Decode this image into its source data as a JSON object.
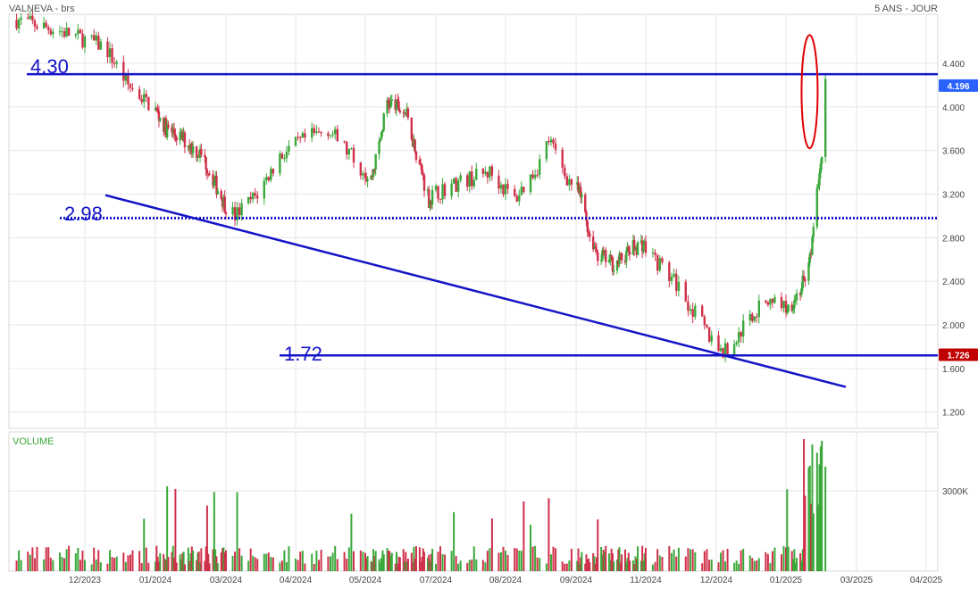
{
  "header": {
    "instrument": "VALNEVA - brs",
    "period": "5 ANS - JOUR"
  },
  "chart_data": {
    "type": "candlestick",
    "price_axis": {
      "ticks": [
        1.2,
        1.6,
        2.0,
        2.4,
        2.8,
        3.2,
        3.6,
        4.0,
        4.4
      ],
      "tick_labels": [
        "1.200",
        "1.600",
        "2.000",
        "2.400",
        "2.800",
        "3.200",
        "3.600",
        "4.000",
        "4.400"
      ],
      "range": [
        1.05,
        4.85
      ]
    },
    "x_axis": {
      "labels": [
        "12/2023",
        "01/2024",
        "03/2024",
        "04/2024",
        "05/2024",
        "07/2024",
        "08/2024",
        "09/2024",
        "11/2024",
        "12/2024",
        "01/2025",
        "03/2025",
        "04/2025"
      ]
    },
    "levels": [
      {
        "value": 4.3,
        "label": "4.30",
        "style": "solid"
      },
      {
        "value": 2.98,
        "label": "2.98",
        "style": "dotted"
      },
      {
        "value": 1.72,
        "label": "1.72",
        "style": "solid"
      }
    ],
    "trendline": {
      "from": {
        "date": "2023-12-10",
        "value": 3.19
      },
      "to": {
        "date": "2025-02-20",
        "value": 1.43
      }
    },
    "last_price": {
      "value": 4.196,
      "label": "4.196",
      "color": "#2962ff"
    },
    "low_price": {
      "value": 1.726,
      "label": "1.726",
      "color": "#c00000"
    },
    "highlight": {
      "type": "ellipse",
      "center_date": "2025-01-20",
      "value_range": [
        3.62,
        4.66
      ],
      "color": "#e00000"
    },
    "series": {
      "approximate_close_path": [
        [
          "2023-11-01",
          4.8
        ],
        [
          "2023-11-20",
          4.7
        ],
        [
          "2023-12-10",
          4.55
        ],
        [
          "2023-12-20",
          4.2
        ],
        [
          "2024-01-10",
          3.8
        ],
        [
          "2024-01-25",
          3.7
        ],
        [
          "2024-02-10",
          3.55
        ],
        [
          "2024-02-25",
          3.2
        ],
        [
          "2024-03-05",
          3.0
        ],
        [
          "2024-03-15",
          3.2
        ],
        [
          "2024-03-25",
          3.55
        ],
        [
          "2024-04-05",
          3.7
        ],
        [
          "2024-04-15",
          3.8
        ],
        [
          "2024-04-25",
          3.55
        ],
        [
          "2024-05-05",
          3.3
        ],
        [
          "2024-05-12",
          3.6
        ],
        [
          "2024-05-20",
          4.05
        ],
        [
          "2024-06-05",
          3.95
        ],
        [
          "2024-06-15",
          3.55
        ],
        [
          "2024-06-25",
          3.15
        ],
        [
          "2024-07-10",
          3.3
        ],
        [
          "2024-07-25",
          3.4
        ],
        [
          "2024-08-05",
          3.15
        ],
        [
          "2024-08-15",
          3.45
        ],
        [
          "2024-08-20",
          3.7
        ],
        [
          "2024-08-28",
          3.35
        ],
        [
          "2024-09-08",
          3.1
        ],
        [
          "2024-09-12",
          2.85
        ],
        [
          "2024-09-20",
          2.65
        ],
        [
          "2024-10-05",
          2.55
        ],
        [
          "2024-10-20",
          2.7
        ],
        [
          "2024-10-30",
          2.75
        ],
        [
          "2024-11-05",
          2.6
        ],
        [
          "2024-11-15",
          2.35
        ],
        [
          "2024-11-22",
          2.1
        ],
        [
          "2024-11-28",
          1.9
        ],
        [
          "2024-12-04",
          1.75
        ],
        [
          "2024-12-08",
          1.8
        ],
        [
          "2024-12-15",
          2.05
        ],
        [
          "2024-12-25",
          2.25
        ],
        [
          "2025-01-02",
          2.15
        ],
        [
          "2025-01-12",
          2.3
        ],
        [
          "2025-01-18",
          2.45
        ],
        [
          "2025-01-22",
          2.7
        ],
        [
          "2025-01-25",
          3.0
        ],
        [
          "2025-01-28",
          3.3
        ],
        [
          "2025-01-31",
          3.6
        ],
        [
          "2025-02-03",
          4.196
        ]
      ]
    },
    "volume": {
      "title": "VOLUME",
      "tick_labels": [
        "3000K"
      ],
      "ticks": [
        3000
      ],
      "range": [
        0,
        5200
      ]
    },
    "grid": true
  }
}
